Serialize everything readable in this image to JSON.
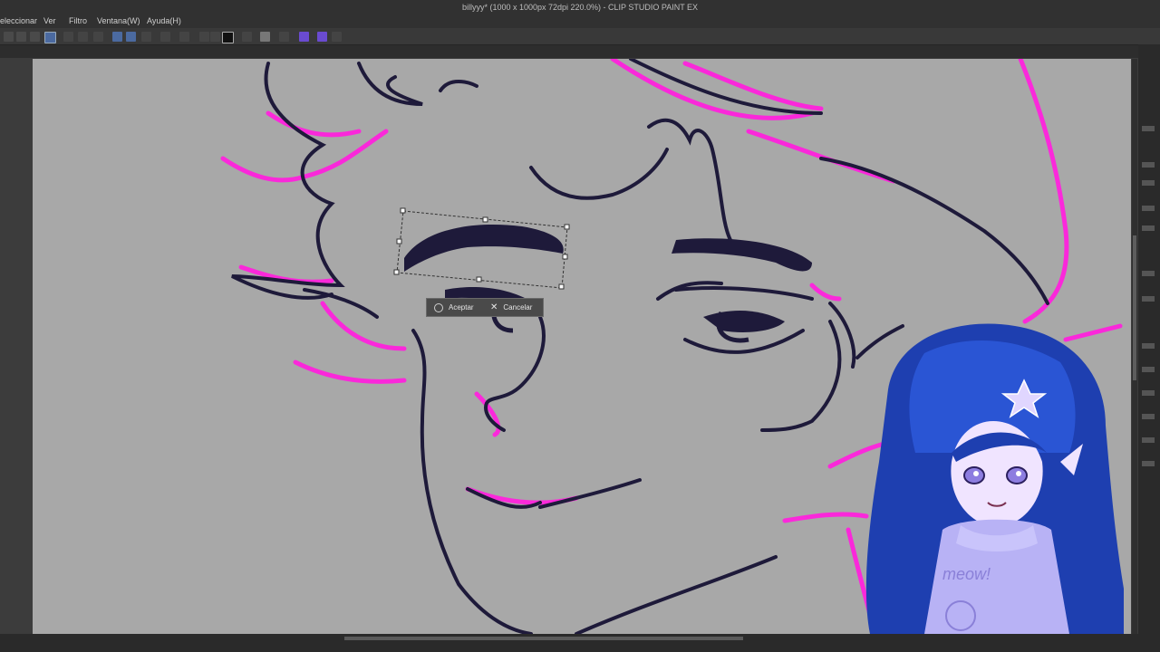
{
  "window": {
    "title": "billyyy* (1000 x 1000px 72dpi 220.0%)  - CLIP STUDIO PAINT EX"
  },
  "menu": {
    "items": [
      {
        "label": "eleccionar"
      },
      {
        "label": "Ver"
      },
      {
        "label": "Filtro"
      },
      {
        "label": "Ventana(W)"
      },
      {
        "label": "Ayuda(H)"
      }
    ]
  },
  "transform": {
    "accept_label": "Aceptar",
    "cancel_label": "Cancelar"
  },
  "overlay": {
    "sweater_text": "meow!"
  },
  "colors": {
    "canvas_bg": "#a8a8a8",
    "line_dark": "#1e1a3a",
    "sketch_magenta": "#ff22dd",
    "accent_purple": "#7a4fd6"
  }
}
